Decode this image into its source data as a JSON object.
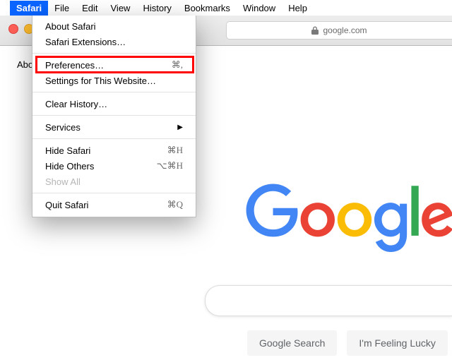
{
  "menubar": {
    "apple": "",
    "items": [
      "Safari",
      "File",
      "Edit",
      "View",
      "History",
      "Bookmarks",
      "Window",
      "Help"
    ],
    "selected": "Safari"
  },
  "window": {
    "address": "google.com"
  },
  "page_text": {
    "about_fragment": "Abo"
  },
  "safari_menu": {
    "about": "About Safari",
    "extensions": "Safari Extensions…",
    "preferences": {
      "label": "Preferences…",
      "shortcut": "⌘,"
    },
    "site_settings": "Settings for This Website…",
    "clear_history": "Clear History…",
    "services": "Services",
    "hide_safari": {
      "label": "Hide Safari",
      "shortcut": "⌘H"
    },
    "hide_others": {
      "label": "Hide Others",
      "shortcut": "⌥⌘H"
    },
    "show_all": "Show All",
    "quit": {
      "label": "Quit Safari",
      "shortcut": "⌘Q"
    }
  },
  "google": {
    "search_label": "Google Search",
    "lucky_label": "I'm Feeling Lucky"
  },
  "colors": {
    "highlight": "#ff0000",
    "menu_highlight": "#0a64ff",
    "google_blue": "#4285F4",
    "google_red": "#EA4335",
    "google_yellow": "#FBBC05",
    "google_green": "#34A853"
  }
}
